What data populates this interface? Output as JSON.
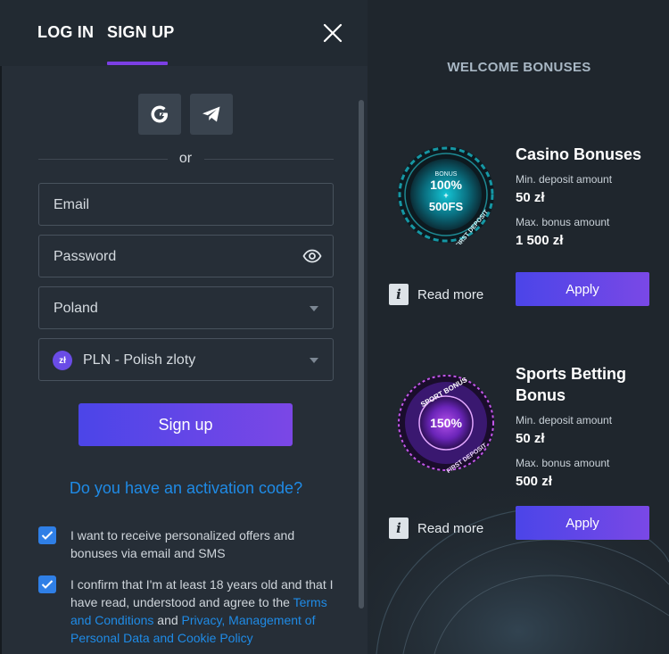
{
  "auth": {
    "tabs": {
      "login": "LOG IN",
      "signup": "SIGN UP"
    },
    "or": "or",
    "fields": {
      "email": "Email",
      "password": "Password",
      "country": "Poland",
      "currency_symbol": "zł",
      "currency": "PLN - Polish zloty"
    },
    "signup_button": "Sign up",
    "activation_link": "Do you have an activation code?",
    "consents": {
      "offers": "I want to receive personalized offers and bonuses via email and SMS",
      "age_prefix": "I confirm that I'm at least 18 years old and that I have read, understood and agree to the ",
      "terms_link": "Terms and Conditions",
      "and": " and ",
      "privacy_link": "Privacy, Management of Personal Data and Cookie Policy"
    }
  },
  "bonuses": {
    "title": "WELCOME BONUSES",
    "items": [
      {
        "title": "Casino Bonuses",
        "badge_top": "BONUS",
        "badge_main1": "100%",
        "badge_plus": "+",
        "badge_main2": "500FS",
        "badge_ring": "FIRST DEPOSIT",
        "min_label": "Min. deposit amount",
        "min_value": "50 zł",
        "max_label": "Max. bonus amount",
        "max_value": "1 500 zł",
        "read_more": "Read more",
        "apply": "Apply"
      },
      {
        "title": "Sports Betting Bonus",
        "badge_ring_top": "SPORT BONUS",
        "badge_main": "150%",
        "badge_ring": "FIRST DEPOSIT",
        "min_label": "Min. deposit amount",
        "min_value": "50 zł",
        "max_label": "Max. bonus amount",
        "max_value": "500 zł",
        "read_more": "Read more",
        "apply": "Apply"
      }
    ]
  },
  "colors": {
    "accent_purple": "#7b3fe4",
    "link_blue": "#1f8be6",
    "panel_left": "#262e37",
    "panel_right": "#1f262d"
  },
  "icons": [
    "close-icon",
    "google-icon",
    "telegram-icon",
    "eye-icon",
    "chevron-down-icon",
    "check-icon",
    "info-icon"
  ]
}
